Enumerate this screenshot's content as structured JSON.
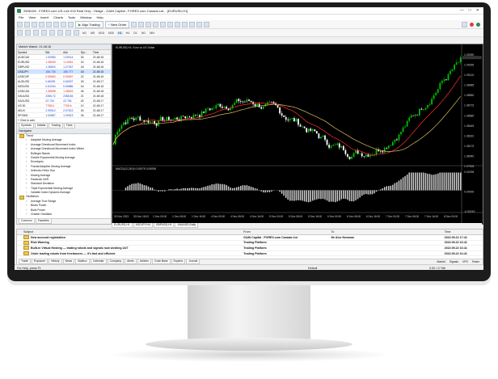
{
  "window": {
    "title": "2506108 - FOREX.com US-Live 015 Real Only - Hedge - GAIN Capital - FOREX.com Canada Ltd. - [EURUSD,H1]",
    "controls": [
      "—",
      "□",
      "✕"
    ]
  },
  "menu": [
    "File",
    "View",
    "Insert",
    "Charts",
    "Tools",
    "Window",
    "Help"
  ],
  "toolbar": {
    "algo_trading": "Algo Trading",
    "new_order": "New Order"
  },
  "timeframes": [
    "M1",
    "M5",
    "M15",
    "M30",
    "H1",
    "H4",
    "D1",
    "W1",
    "MN"
  ],
  "market_watch": {
    "title": "Market Watch: 21:48:16",
    "columns": [
      "Symbol",
      "Bid",
      "Ask",
      "Spr...",
      "Time"
    ],
    "rows": [
      {
        "symbol": "AUDCAD",
        "bid": "1.00983",
        "ask": "1.00014",
        "spread": "30",
        "time": "21:48:15"
      },
      {
        "symbol": "EURUSD",
        "bid": "1.08009",
        "ask": "1.10051",
        "spread": "15",
        "time": "21:48:16"
      },
      {
        "symbol": "GBPUSD",
        "bid": "1.26820",
        "ask": "1.27347",
        "spread": "18",
        "time": "21:48:16"
      },
      {
        "symbol": "USDJPY",
        "bid": "156.735",
        "ask": "156.777",
        "spread": "18",
        "time": "21:48:15"
      },
      {
        "symbol": "USDCHF",
        "bid": "0.90663",
        "ask": "0.90697",
        "spread": "22",
        "time": "21:48:15"
      },
      {
        "symbol": "AUDUSD",
        "bid": "0.66281",
        "ask": "0.66307",
        "spread": "26",
        "time": "21:48:17"
      },
      {
        "symbol": "NZDUSD",
        "bid": "0.61034",
        "ask": "0.60886",
        "spread": "16",
        "time": "21:48:15"
      },
      {
        "symbol": "USDCAD",
        "bid": "1.36598",
        "ask": "1.36623",
        "spread": "46",
        "time": "21:48:18"
      },
      {
        "symbol": "XAUUSD",
        "bid": "2356.72",
        "ask": "2358.84",
        "spread": "21",
        "time": "21:48:18"
      },
      {
        "symbol": "XAGUSD",
        "bid": "22.734",
        "ask": "22.784",
        "spread": "40",
        "time": "21:48:17"
      },
      {
        "symbol": "US.30",
        "bid": "7758.6",
        "ask": "7759.6",
        "spread": "10",
        "time": "21:48:17"
      },
      {
        "symbol": "#EUX",
        "bid": "2.99912",
        "ask": "2.97513",
        "spread": "25",
        "time": "21:48:17"
      },
      {
        "symbol": "SPX500",
        "bid": "1.00887",
        "ask": "1.00913",
        "spread": "26",
        "time": "21:48:17"
      },
      {
        "symbol": "+ Click to add",
        "bid": "",
        "ask": "",
        "spread": "",
        "time": ""
      }
    ],
    "tabs": [
      "Symbols",
      "Details",
      "Trading",
      "Ticks"
    ]
  },
  "navigator": {
    "title": "Navigator",
    "items": [
      {
        "type": "folder",
        "label": "Trend"
      },
      {
        "type": "ind",
        "label": "Adaptive Moving Average"
      },
      {
        "type": "ind",
        "label": "Average Directional Movement Index"
      },
      {
        "type": "ind",
        "label": "Average Directional Movement Index Wilder"
      },
      {
        "type": "ind",
        "label": "Bollinger Bands"
      },
      {
        "type": "ind",
        "label": "Double Exponential Moving Average"
      },
      {
        "type": "ind",
        "label": "Envelopes"
      },
      {
        "type": "ind",
        "label": "Fractal Adaptive Moving Average"
      },
      {
        "type": "ind",
        "label": "Ichimoku Kinko Hyo"
      },
      {
        "type": "ind",
        "label": "Moving Average"
      },
      {
        "type": "ind",
        "label": "Parabolic SAR"
      },
      {
        "type": "ind",
        "label": "Standard Deviation"
      },
      {
        "type": "ind",
        "label": "Triple Exponential Moving Average"
      },
      {
        "type": "ind",
        "label": "Variable Index Dynamic Average"
      },
      {
        "type": "folder",
        "label": "Oscillators"
      },
      {
        "type": "ind",
        "label": "Average True Range"
      },
      {
        "type": "ind",
        "label": "Bears Power"
      },
      {
        "type": "ind",
        "label": "Bulls Power"
      },
      {
        "type": "ind",
        "label": "Chaikin Oscillator"
      }
    ],
    "tabs": [
      "Common",
      "Favorites"
    ]
  },
  "chart": {
    "title": "EURUSD,H1: Euro vs US Dollar",
    "osc_title": "MACD(12,26,9) 0.00079 0.00096",
    "price_labels": [
      "1.09390",
      "1.09255",
      "1.09120",
      "1.08985",
      "1.08850",
      "1.08715",
      "1.08580",
      "1.08445",
      "1.08310",
      "1.08175",
      "1.08040",
      "1.07905"
    ],
    "osc_labels": [
      "0.00295",
      "0.00000",
      "-0.00219"
    ],
    "time_labels": [
      "30 Nov 2023",
      "30 Nov 16:00",
      "1 Dec 00:00",
      "1 Dec 08:00",
      "1 Dec 16:00",
      "4 Dec 00:00",
      "4 Dec 08:00",
      "4 Dec 16:00",
      "5 Dec 00:00",
      "5 Dec 08:00",
      "5 Dec 16:00",
      "6 Dec 00:00",
      "6 Dec 08:00",
      "6 Dec 16:00",
      "7 Dec 00:00",
      "7 Dec 08:00",
      "7 Dec 16:00",
      "8 Dec 00:00"
    ],
    "tabs": [
      "EURUSD,H1",
      "USDJPY,H4",
      "GBPUSD,H1",
      "XAUUSD,Daily"
    ]
  },
  "toolbox": {
    "columns": [
      "Subject",
      "From",
      "To",
      "Time"
    ],
    "messages": [
      {
        "subject": "New account registration",
        "from": "GAIN Capital - FOREX.com Canada Ltd.",
        "to": "Mr Alex Newman",
        "time": "2022.09.22 17:41"
      },
      {
        "subject": "Risk Warning",
        "from": "Trading Platform",
        "to": "",
        "time": "2022.09.22 16:41"
      },
      {
        "subject": "Built-in Virtual Hosting — trading robots and signals now working 24/7",
        "from": "Trading Platform",
        "to": "",
        "time": "2022.09.22 16:41"
      },
      {
        "subject": "Order trading robots from freelancers — it's fast and efficient",
        "from": "Trading Platform",
        "to": "",
        "time": "2022.09.22 16:41"
      }
    ],
    "tabs": [
      "Trade",
      "Exposure",
      "History",
      "News",
      "Mailbox",
      "Calendar",
      "Company",
      "Alerts",
      "Articles",
      "Code Base",
      "Experts",
      "Journal"
    ],
    "right_tabs": [
      "Market",
      "Signals",
      "VPS",
      "Tester"
    ]
  },
  "status": {
    "help": "For Help, press F1",
    "profile": "Default",
    "ping": "0.00 / 17 Mb"
  },
  "colors": {
    "chart_bg": "#000000",
    "bull_candle": "#00c000",
    "bear_candle": "#ffffff",
    "ma_red": "#ff3030",
    "ma_yellow": "#e0c060"
  }
}
